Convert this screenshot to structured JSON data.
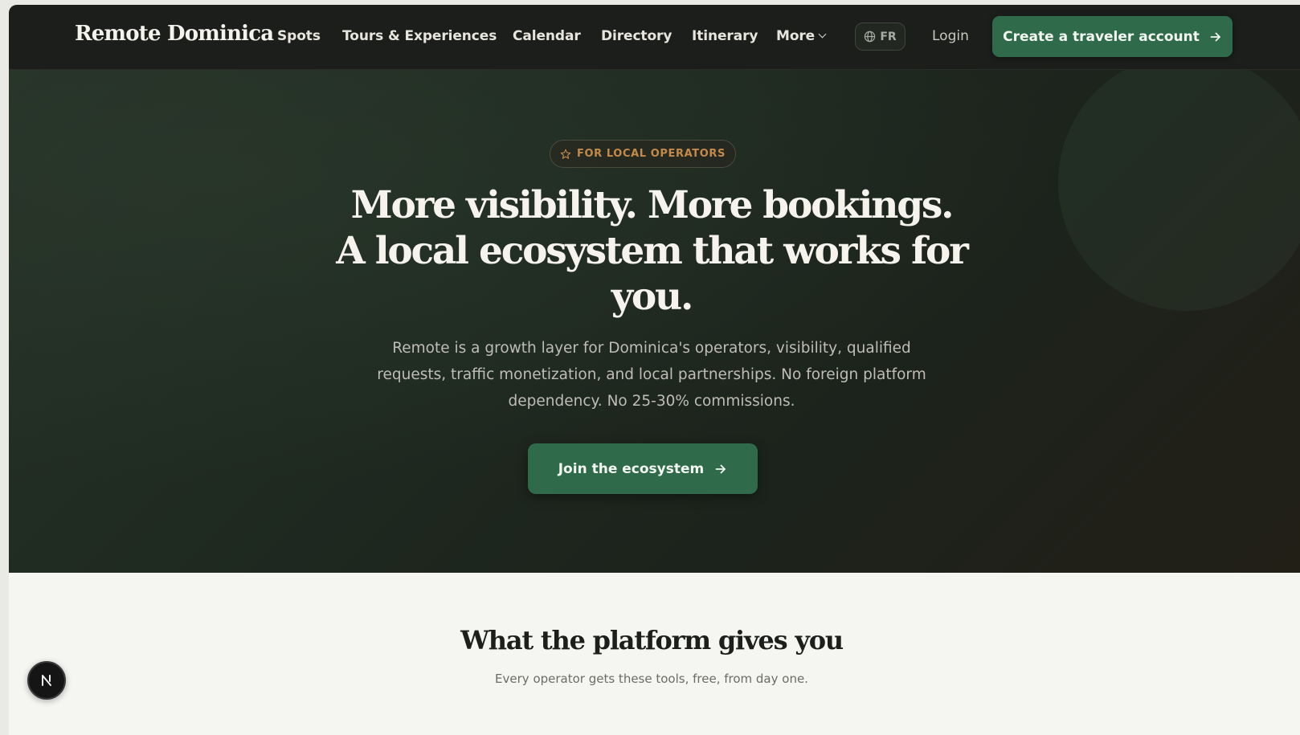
{
  "nav": {
    "logo": "Remote Dominica",
    "links": [
      "Spots",
      "Tours & Experiences",
      "Calendar",
      "Directory",
      "Itinerary"
    ],
    "more_label": "More",
    "lang_label": "FR",
    "login_label": "Login",
    "cta_label": "Create a traveler account"
  },
  "hero": {
    "badge": "FOR LOCAL OPERATORS",
    "title_line1": "More visibility. More bookings.",
    "title_line2": "A local ecosystem that works for you.",
    "subtitle": "Remote is a growth layer for Dominica's operators, visibility, qualified requests, traffic monetization, and local partnerships. No foreign platform dependency. No 25-30% commissions.",
    "cta_label": "Join the ecosystem"
  },
  "section": {
    "title": "What the platform gives you",
    "subtitle": "Every operator gets these tools, free, from day one."
  },
  "fab": {
    "label": "N"
  },
  "colors": {
    "nav_bg": "#1b1e1a",
    "accent_green": "#2f6b4b",
    "badge_text": "#c48a4a",
    "page_bg": "#f5f5f2"
  },
  "icons": {
    "globe": "globe-icon",
    "arrow": "arrow-right-icon",
    "star": "star-icon",
    "chevron": "chevron-down-icon"
  }
}
